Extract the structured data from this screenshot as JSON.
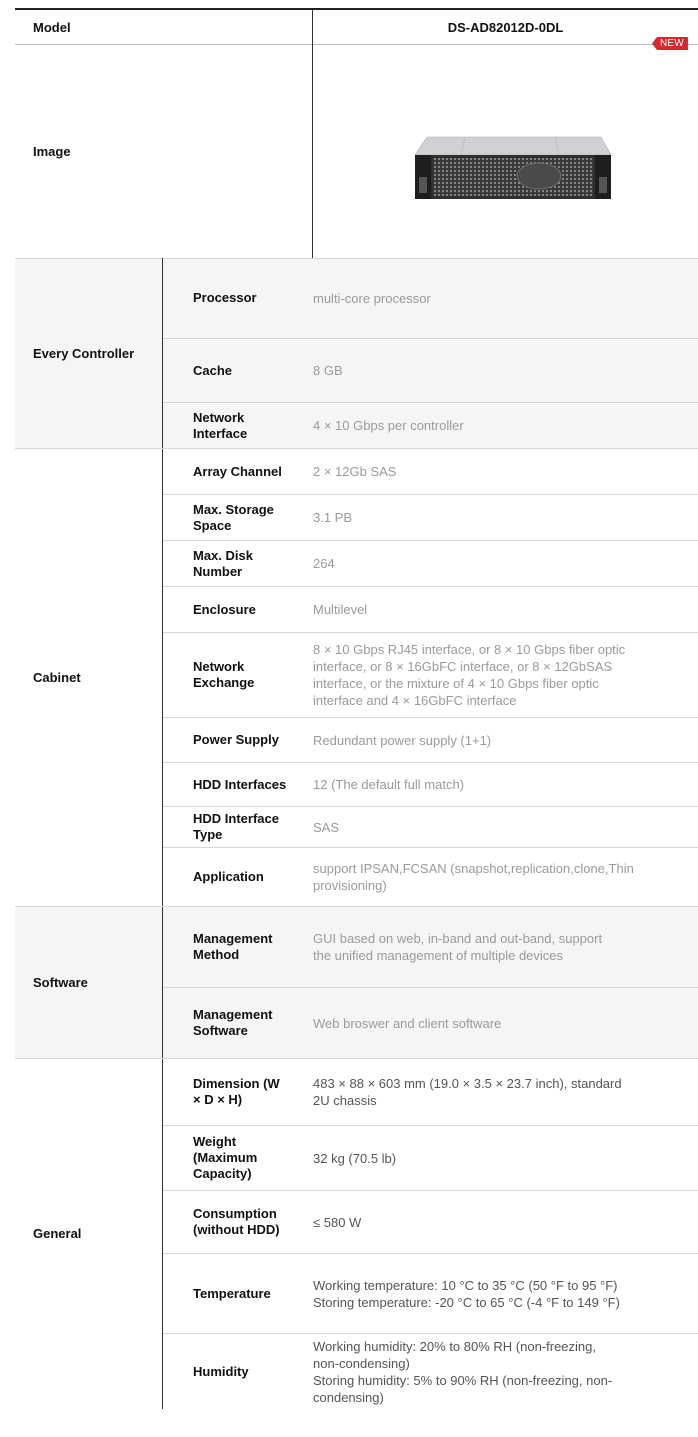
{
  "header": {
    "model_label": "Model",
    "model_value": "DS-AD82012D-0DL"
  },
  "image_row": {
    "label": "Image",
    "badge": "NEW",
    "product_image": "rack-storage-enclosure"
  },
  "groups": {
    "every_controller": "Every Controller",
    "cabinet": "Cabinet",
    "software": "Software",
    "general": "General"
  },
  "rows": [
    {
      "label": "Processor",
      "value": "multi-core processor"
    },
    {
      "label": "Cache",
      "value": "8 GB"
    },
    {
      "label": "Network\nInterface",
      "value": "4 × 10 Gbps per controller"
    },
    {
      "label": "Array Channel",
      "value": "2 × 12Gb SAS"
    },
    {
      "label": "Max. Storage\nSpace",
      "value": "3.1 PB"
    },
    {
      "label": "Max. Disk\nNumber",
      "value": "264"
    },
    {
      "label": "Enclosure",
      "value": "Multilevel"
    },
    {
      "label": "Network\nExchange",
      "value": "8 × 10 Gbps RJ45 interface, or 8 × 10 Gbps fiber optic\ninterface, or 8 × 16GbFC interface, or 8 × 12GbSAS\ninterface, or the mixture of 4 × 10 Gbps fiber optic\ninterface and 4 × 16GbFC interface"
    },
    {
      "label": "Power Supply",
      "value": "Redundant power supply (1+1)"
    },
    {
      "label": "HDD Interfaces",
      "value": "12 (The default full match)"
    },
    {
      "label": "HDD Interface\nType",
      "value": "SAS"
    },
    {
      "label": "Application",
      "value": "support IPSAN,FCSAN (snapshot,replication,clone,Thin\nprovisioning)"
    },
    {
      "label": "Management\nMethod",
      "value": "GUI based on web, in-band and out-band, support\nthe unified management of multiple devices"
    },
    {
      "label": "Management\nSoftware",
      "value": "Web broswer and client software"
    },
    {
      "label": "Dimension (W\n× D × H)",
      "value": "483 × 88 × 603 mm (19.0 × 3.5 × 23.7 inch), standard\n2U chassis"
    },
    {
      "label": "Weight\n(Maximum\nCapacity)",
      "value": "32 kg (70.5 lb)"
    },
    {
      "label": "Consumption\n(without HDD)",
      "value": "≤ 580 W"
    },
    {
      "label": "Temperature",
      "value": "Working temperature: 10 °C to 35 °C (50 °F to 95 °F)\nStoring temperature: -20 °C to 65 °C (-4 °F to 149 °F)"
    },
    {
      "label": "Humidity",
      "value": "Working humidity: 20% to 80% RH (non-freezing,\nnon-condensing)\nStoring humidity: 5% to 90% RH (non-freezing, non-\ncondensing)"
    }
  ]
}
